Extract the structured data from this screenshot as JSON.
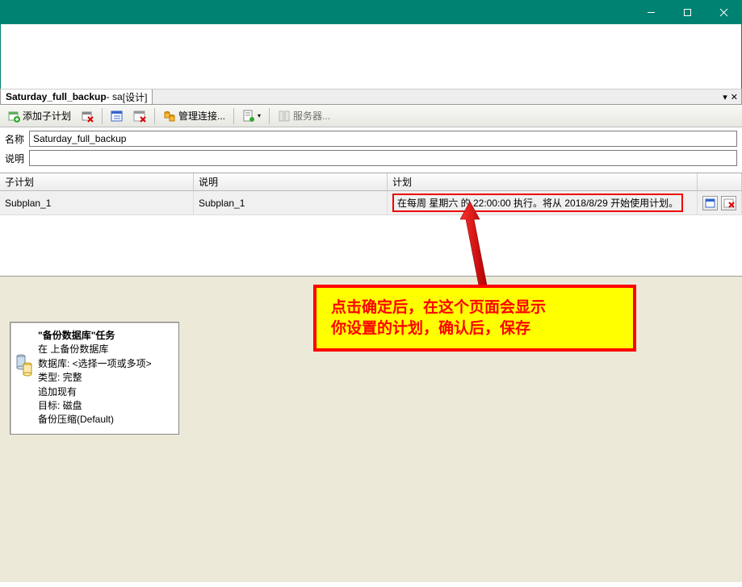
{
  "window": {
    "tab_title_name": "Saturday_full_backup",
    "tab_title_user": " - sa ",
    "tab_title_mode": "[设计]"
  },
  "toolbar": {
    "add_subplan": "添加子计划",
    "manage_conn": "管理连接...",
    "servers": "服务器..."
  },
  "form": {
    "name_label": "名称",
    "name_value": "Saturday_full_backup",
    "desc_label": "说明",
    "desc_value": ""
  },
  "grid": {
    "headers": {
      "subplan": "子计划",
      "desc": "说明",
      "plan": "计划"
    },
    "rows": [
      {
        "subplan": "Subplan_1",
        "desc": "Subplan_1",
        "plan": "在每周 星期六 的 22:00:00 执行。将从 2018/8/29 开始使用计划。"
      }
    ]
  },
  "task_box": {
    "title": "\"备份数据库\"任务",
    "lines": [
      "在 上备份数据库",
      "数据库: <选择一项或多项>",
      "类型: 完整",
      "追加现有",
      "目标: 磁盘",
      "备份压缩(Default)"
    ]
  },
  "annotation": {
    "line1": "点击确定后，在这个页面会显示",
    "line2": "你设置的计划，确认后，保存"
  }
}
